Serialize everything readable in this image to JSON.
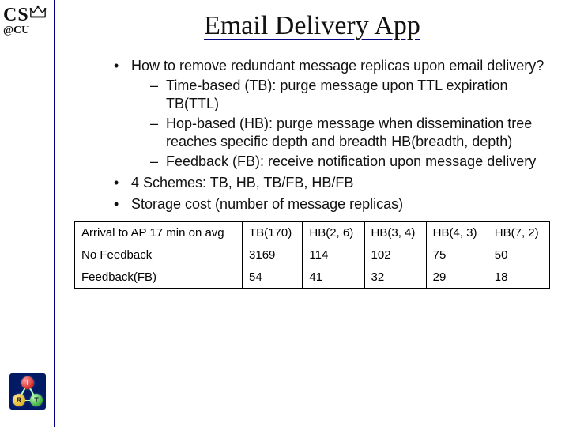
{
  "logo": {
    "cs": "CS",
    "atcu": "@CU",
    "nodes": [
      "I",
      "R",
      "T"
    ]
  },
  "title": "Email Delivery App",
  "bullets": {
    "b1": "How to remove redundant message replicas upon email delivery?",
    "b1a": "Time-based (TB): purge message upon TTL expiration TB(TTL)",
    "b1b": "Hop-based (HB): purge message when dissemination tree reaches specific depth and breadth  HB(breadth, depth)",
    "b1c": "Feedback (FB): receive notification upon message delivery",
    "b2": "4 Schemes: TB, HB, TB/FB, HB/FB",
    "b3": "Storage cost (number of message replicas)"
  },
  "table": {
    "headers": [
      "Arrival to AP 17 min on avg",
      "TB(170)",
      "HB(2, 6)",
      "HB(3, 4)",
      "HB(4, 3)",
      "HB(7, 2)"
    ],
    "rows": [
      {
        "label": "No Feedback",
        "cells": [
          "3169",
          "114",
          "102",
          "75",
          "50"
        ]
      },
      {
        "label": "Feedback(FB)",
        "cells": [
          "54",
          "41",
          "32",
          "29",
          "18"
        ]
      }
    ]
  },
  "chart_data": {
    "type": "table",
    "title": "Storage cost (number of message replicas)",
    "row_header": "Arrival to AP 17 min on avg",
    "columns": [
      "TB(170)",
      "HB(2, 6)",
      "HB(3, 4)",
      "HB(4, 3)",
      "HB(7, 2)"
    ],
    "series": [
      {
        "name": "No Feedback",
        "values": [
          3169,
          114,
          102,
          75,
          50
        ]
      },
      {
        "name": "Feedback(FB)",
        "values": [
          54,
          41,
          32,
          29,
          18
        ]
      }
    ]
  }
}
